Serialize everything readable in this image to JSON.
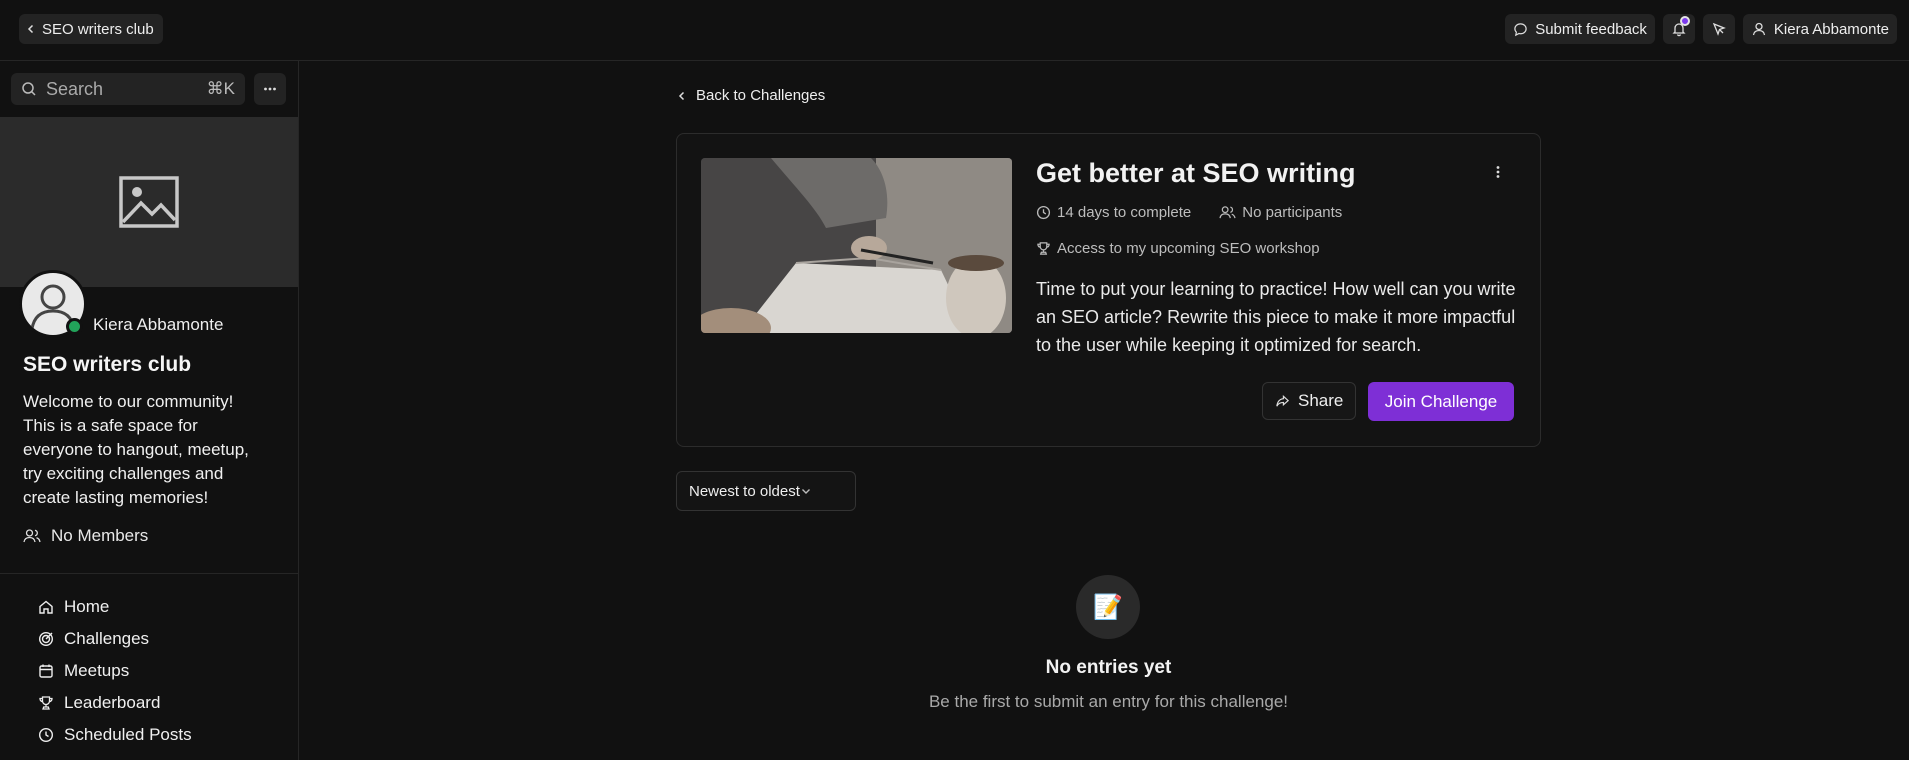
{
  "topbar": {
    "back_label": "SEO writers club",
    "feedback_label": "Submit feedback",
    "user_name": "Kiera Abbamonte"
  },
  "sidebar": {
    "search_placeholder": "Search",
    "search_shortcut": "⌘K",
    "owner_name": "Kiera Abbamonte",
    "club_title": "SEO writers club",
    "club_description": "Welcome to our community! This is a safe space for everyone to hangout, meetup, try exciting challenges and create lasting memories!",
    "members_label": "No Members",
    "nav": [
      {
        "label": "Home",
        "icon": "home-icon"
      },
      {
        "label": "Challenges",
        "icon": "target-icon"
      },
      {
        "label": "Meetups",
        "icon": "calendar-icon"
      },
      {
        "label": "Leaderboard",
        "icon": "trophy-icon"
      },
      {
        "label": "Scheduled Posts",
        "icon": "clock-icon"
      }
    ]
  },
  "main": {
    "back_label": "Back to Challenges",
    "challenge": {
      "title": "Get better at SEO writing",
      "duration": "14 days to complete",
      "participants": "No participants",
      "reward": "Access to my upcoming SEO workshop",
      "description": "Time to put your learning to practice! How well can you write an SEO article? Rewrite this piece to make it more impactful to the user while keeping it optimized for search.",
      "share_label": "Share",
      "join_label": "Join Challenge"
    },
    "sort_value": "Newest to oldest",
    "empty": {
      "icon": "📝",
      "title": "No entries yet",
      "subtitle": "Be the first to submit an entry for this challenge!"
    }
  },
  "colors": {
    "accent": "#7e2fd6",
    "online": "#22a35a",
    "background": "#111111"
  }
}
